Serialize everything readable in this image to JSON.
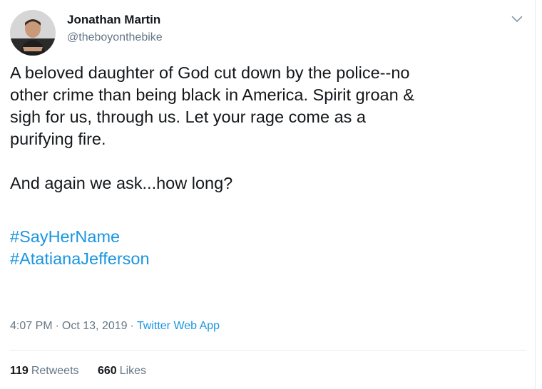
{
  "author": {
    "name": "Jonathan Martin",
    "handle": "@theboyonthebike"
  },
  "tweet": {
    "lines": [
      "A beloved daughter of God cut down by the police--no",
      "other crime than being black in America. Spirit groan &",
      "sigh for us, through us. Let your rage come as a",
      "purifying fire."
    ],
    "line2": "And again we ask...how long?",
    "hashtags": [
      "#SayHerName",
      "#AtatianaJefferson"
    ]
  },
  "meta": {
    "time": "4:07 PM",
    "separator": "·",
    "date": "Oct 13, 2019",
    "source": "Twitter Web App"
  },
  "stats": {
    "retweets_count": "119",
    "retweets_label": "Retweets",
    "likes_count": "660",
    "likes_label": "Likes"
  },
  "colors": {
    "link": "#1b95e0",
    "secondary_text": "#657786",
    "primary_text": "#14171a",
    "divider": "#e6ecf0"
  },
  "icons": {
    "menu": "chevron-down-icon"
  }
}
